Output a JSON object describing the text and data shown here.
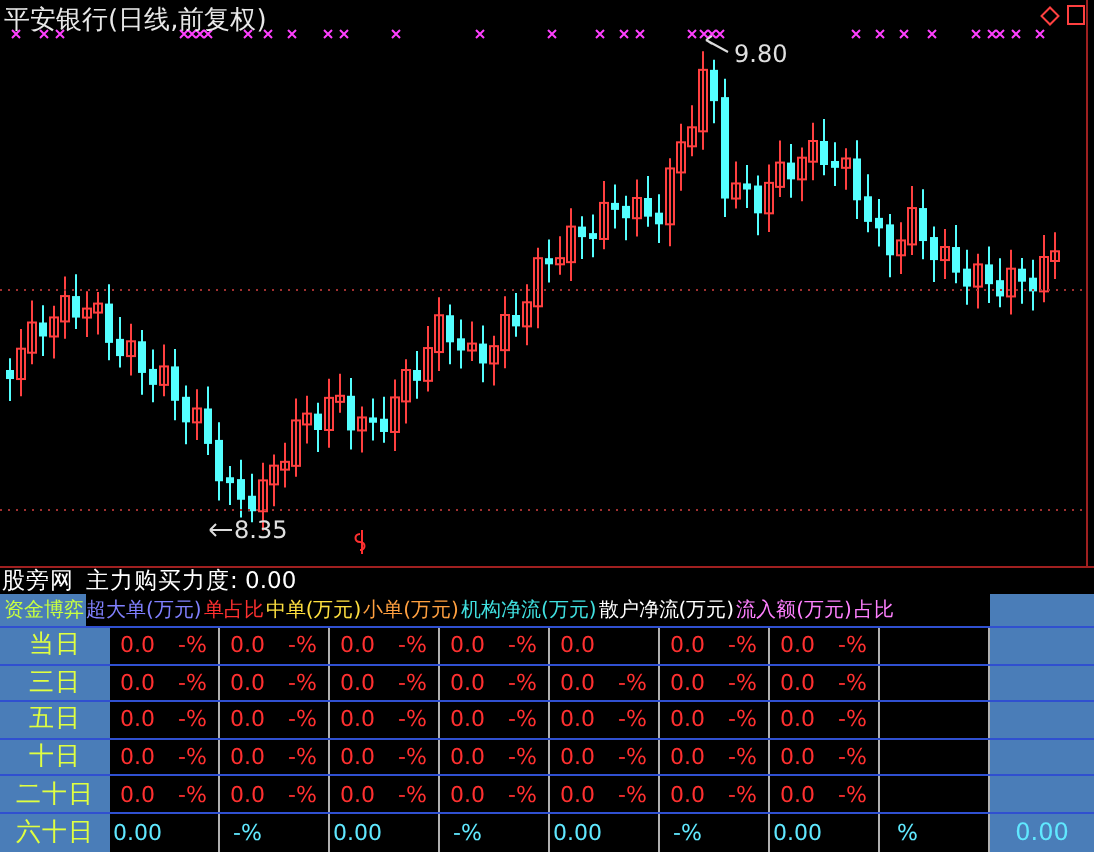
{
  "chart": {
    "title": "平安银行(日线,前复权)",
    "high_label": "9.80",
    "low_label": "8.35"
  },
  "indicator": {
    "name": "股旁网",
    "label": "主力购买力度: 0.00"
  },
  "table": {
    "headers": [
      {
        "text": "资金博弈",
        "color": "#c8ff40"
      },
      {
        "text": "超大单(万元)",
        "color": "#8080ff"
      },
      {
        "text": "单占比",
        "color": "#ff3030"
      },
      {
        "text": "中单(万元)",
        "color": "#ffe040"
      },
      {
        "text": "小单(万元)",
        "color": "#ffa040"
      },
      {
        "text": "机构净流(万元)",
        "color": "#40e0e0"
      },
      {
        "text": "散户净流(万元)",
        "color": "#ffffff"
      },
      {
        "text": "流入额(万元)",
        "color": "#ff80ff"
      },
      {
        "text": "占比",
        "color": "#ff80ff"
      }
    ],
    "rows": [
      {
        "label": "当日",
        "kind": "detail",
        "cells": [
          "0.0",
          "-%",
          "0.0",
          "-%",
          "0.0",
          "-%",
          "0.0",
          "-%",
          "0.0",
          null,
          "0.0",
          "-%",
          "0.0",
          "-%",
          null,
          null
        ]
      },
      {
        "label": "三日",
        "kind": "detail",
        "cells": [
          "0.0",
          "-%",
          "0.0",
          "-%",
          "0.0",
          "-%",
          "0.0",
          "-%",
          "0.0",
          "-%",
          "0.0",
          "-%",
          "0.0",
          "-%",
          null,
          null
        ]
      },
      {
        "label": "五日",
        "kind": "detail",
        "cells": [
          "0.0",
          "-%",
          "0.0",
          "-%",
          "0.0",
          "-%",
          "0.0",
          "-%",
          "0.0",
          "-%",
          "0.0",
          "-%",
          "0.0",
          "-%",
          null,
          null
        ]
      },
      {
        "label": "十日",
        "kind": "detail",
        "cells": [
          "0.0",
          "-%",
          "0.0",
          "-%",
          "0.0",
          "-%",
          "0.0",
          "-%",
          "0.0",
          "-%",
          "0.0",
          "-%",
          "0.0",
          "-%",
          null,
          null
        ]
      },
      {
        "label": "二十日",
        "kind": "detail",
        "cells": [
          "0.0",
          "-%",
          "0.0",
          "-%",
          "0.0",
          "-%",
          "0.0",
          "-%",
          "0.0",
          "-%",
          "0.0",
          "-%",
          "0.0",
          "-%",
          null,
          null
        ]
      },
      {
        "label": "六十日",
        "kind": "total",
        "cells": [
          "0.00",
          null,
          "-%",
          null,
          "0.00",
          null,
          "-%",
          null,
          "0.00",
          null,
          "-%",
          null,
          "0.00",
          null,
          "%",
          null
        ],
        "side_value": "0.00"
      }
    ]
  }
}
